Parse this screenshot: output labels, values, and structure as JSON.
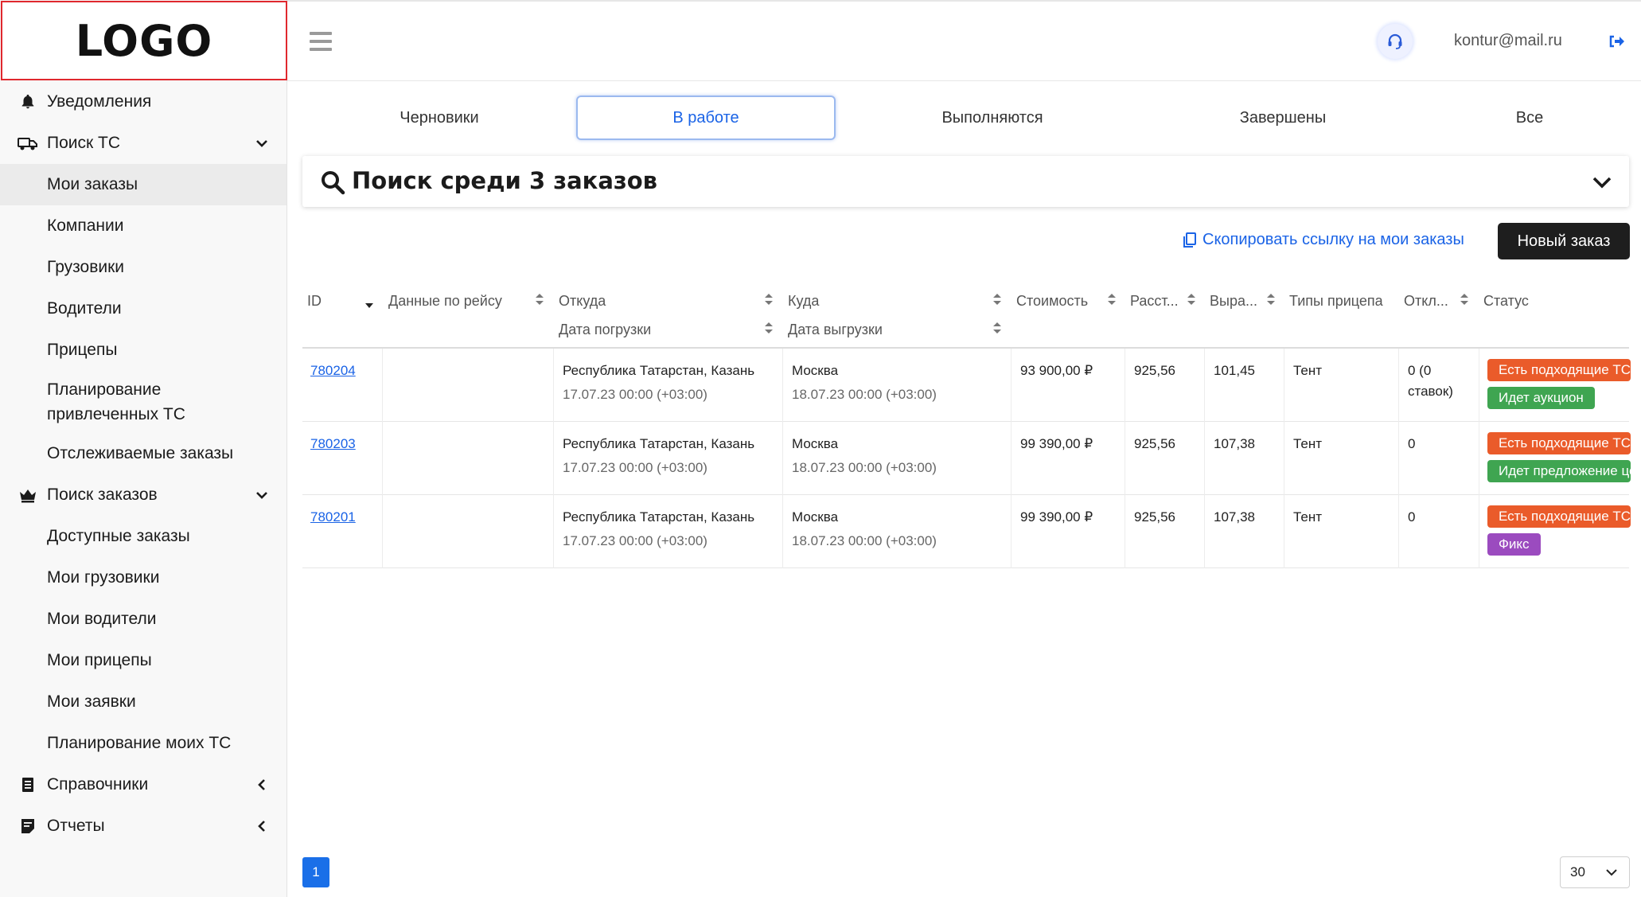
{
  "logo": {
    "text": "LOGO"
  },
  "sidebar": {
    "items": [
      {
        "label": "Уведомления"
      },
      {
        "label": "Поиск ТС"
      },
      {
        "label": "Мои заказы"
      },
      {
        "label": "Компании"
      },
      {
        "label": "Грузовики"
      },
      {
        "label": "Водители"
      },
      {
        "label": "Прицепы"
      },
      {
        "label": "Планирование привлеченных ТС"
      },
      {
        "label": "Отслеживаемые заказы"
      },
      {
        "label": "Поиск заказов"
      },
      {
        "label": "Доступные заказы"
      },
      {
        "label": "Мои грузовики"
      },
      {
        "label": "Мои водители"
      },
      {
        "label": "Мои прицепы"
      },
      {
        "label": "Мои заявки"
      },
      {
        "label": "Планирование моих ТС"
      },
      {
        "label": "Справочники"
      },
      {
        "label": "Отчеты"
      }
    ]
  },
  "header": {
    "email": "kontur@mail.ru"
  },
  "tabs": [
    {
      "label": "Черновики"
    },
    {
      "label": "В работе"
    },
    {
      "label": "Выполняются"
    },
    {
      "label": "Завершены"
    },
    {
      "label": "Все"
    }
  ],
  "search": {
    "title": "Поиск среди 3 заказов"
  },
  "actions": {
    "copy_link": "Скопировать ссылку на мои заказы",
    "new_order": "Новый заказ"
  },
  "table": {
    "columns": {
      "id": "ID",
      "trip": "Данные по рейсу",
      "from": "Откуда",
      "load_date": "Дата погрузки",
      "to": "Куда",
      "unload_date": "Дата выгрузки",
      "cost": "Стоимость",
      "distance": "Расст...",
      "revenue": "Выра...",
      "trailer": "Типы прицепа",
      "responses": "Откл...",
      "status": "Статус"
    },
    "rows": [
      {
        "id": "780204",
        "from": "Республика Татарстан, Казань",
        "load_date": "17.07.23 00:00 (+03:00)",
        "to": "Москва",
        "unload_date": "18.07.23 00:00 (+03:00)",
        "cost": "93 900,00 ₽",
        "distance": "925,56",
        "revenue": "101,45",
        "trailer": "Тент",
        "responses_line1": "0 (0",
        "responses_line2": "ставок)",
        "badge1": "Есть подходящие ТС",
        "badge2": "Идет аукцион"
      },
      {
        "id": "780203",
        "from": "Республика Татарстан, Казань",
        "load_date": "17.07.23 00:00 (+03:00)",
        "to": "Москва",
        "unload_date": "18.07.23 00:00 (+03:00)",
        "cost": "99 390,00 ₽",
        "distance": "925,56",
        "revenue": "107,38",
        "trailer": "Тент",
        "responses_line1": "0",
        "responses_line2": "",
        "badge1": "Есть подходящие ТС",
        "badge2": "Идет предложение цены"
      },
      {
        "id": "780201",
        "from": "Республика Татарстан, Казань",
        "load_date": "17.07.23 00:00 (+03:00)",
        "to": "Москва",
        "unload_date": "18.07.23 00:00 (+03:00)",
        "cost": "99 390,00 ₽",
        "distance": "925,56",
        "revenue": "107,38",
        "trailer": "Тент",
        "responses_line1": "0",
        "responses_line2": "",
        "badge1": "Есть подходящие ТС",
        "badge2": "Фикс"
      }
    ]
  },
  "pagination": {
    "current_page": "1",
    "per_page": "30"
  },
  "colors": {
    "accent": "#1a63e6",
    "badge_orange": "#ea5b2a",
    "badge_green": "#3fa551",
    "badge_purple": "#9b4bbf",
    "logo_border": "#e0282e"
  },
  "icons": {
    "notifications": "bell-icon",
    "vehicle_search": "truck-icon",
    "order_search": "crown-icon",
    "references": "book-icon",
    "reports": "report-icon",
    "search": "search-icon",
    "copy": "copy-icon",
    "support": "headset-icon",
    "logout": "logout-icon"
  }
}
